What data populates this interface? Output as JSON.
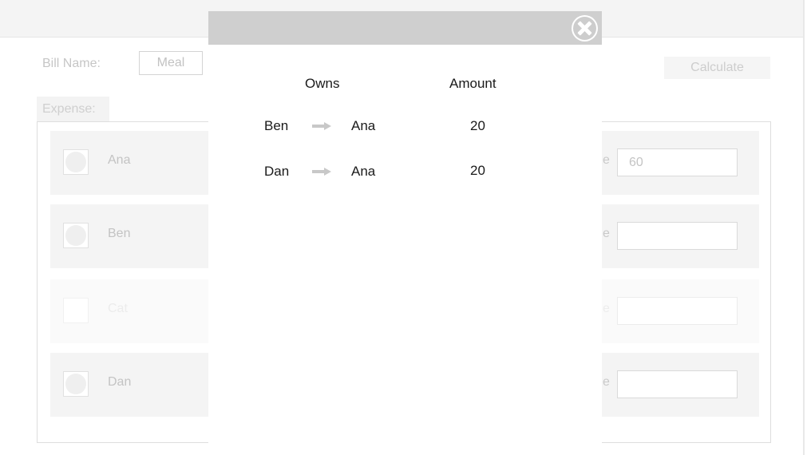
{
  "background": {
    "bill_label": "Bill Name:",
    "bill_value": "Meal",
    "calculate_label": "Calculate",
    "expense_label": "Expense:",
    "rows": [
      {
        "name": "Ana",
        "side_label": "e",
        "amount": "60"
      },
      {
        "name": "Ben",
        "side_label": "e",
        "amount": ""
      },
      {
        "name": "Cat",
        "side_label": "e",
        "amount": ""
      },
      {
        "name": "Dan",
        "side_label": "e",
        "amount": ""
      }
    ]
  },
  "modal": {
    "close_icon": "close-circle-x",
    "headers": {
      "owns": "Owns",
      "amount": "Amount"
    },
    "arrow_icon": "right-arrow",
    "debts": [
      {
        "from": "Ben",
        "to": "Ana",
        "amount": "20"
      },
      {
        "from": "Dan",
        "to": "Ana",
        "amount": "20"
      }
    ]
  },
  "colors": {
    "modal_header": "#cfcfcf",
    "arrow": "#c8c8c8"
  }
}
